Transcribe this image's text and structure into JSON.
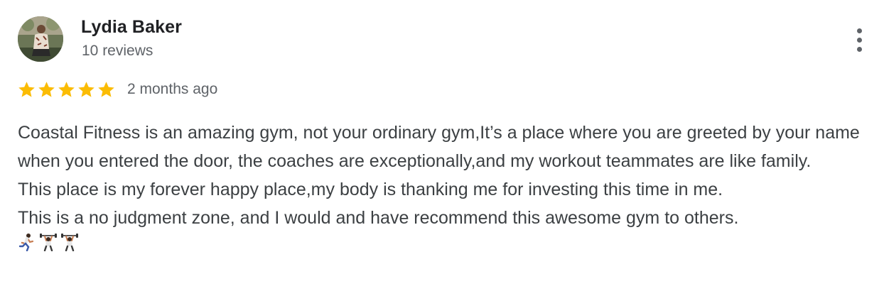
{
  "reviewer": {
    "name": "Lydia Baker",
    "review_count": "10 reviews"
  },
  "rating": {
    "stars": 5,
    "max": 5,
    "date": "2 months ago",
    "star_color": "#fbbc04"
  },
  "review_text": {
    "paragraph_1": "Coastal Fitness is an amazing gym, not your ordinary gym,It’s a place where you are greeted by your name when you entered the door, the coaches are exceptionally,and my workout teammates are like family.",
    "paragraph_2": "This place is my forever happy place,my body is thanking me for investing this time in me.",
    "paragraph_3": "This is a no judgment zone, and I would and have recommend this awesome gym to others."
  },
  "emojis": [
    "person-running-icon",
    "person-lifting-weights-icon",
    "person-lifting-weights-icon"
  ],
  "icons": {
    "menu": "more-vert-icon",
    "avatar": "profile-photo"
  }
}
